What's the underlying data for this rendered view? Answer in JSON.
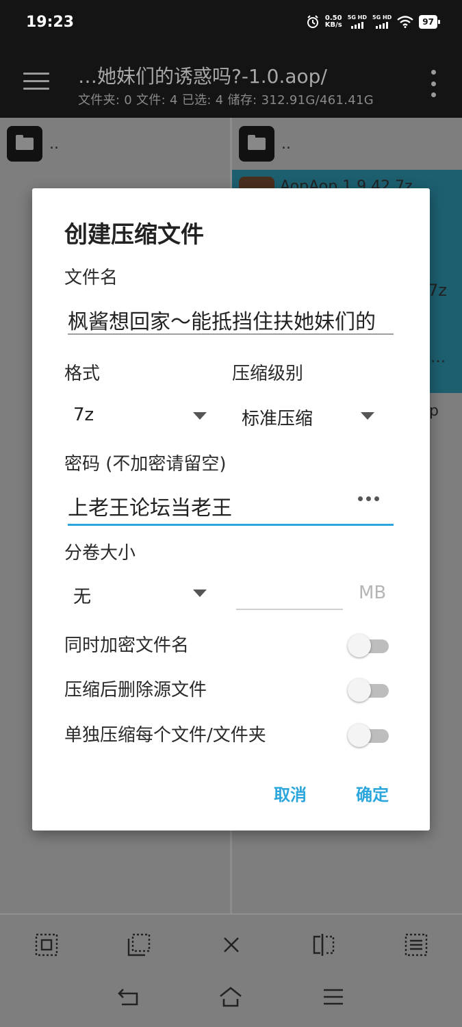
{
  "status_bar": {
    "time": "19:23",
    "net_speed_value": "0.50",
    "net_speed_unit": "KB/s",
    "sim1": "5G HD",
    "sim2": "5G HD",
    "battery": "97"
  },
  "app_bar": {
    "title": "…她妹们的诱惑吗?-1.0.aop/",
    "subtitle": "文件夹: 0  文件: 4  已选: 4  储存: 312.91G/461.41G"
  },
  "left_pane": {
    "parent_label": ".."
  },
  "right_pane": {
    "parent_label": "..",
    "selected_item": "AopAop 1.9.42.7z",
    "peek_1": "7z",
    "peek_2": "…",
    "peek_3": "p"
  },
  "dialog": {
    "title": "创建压缩文件",
    "filename_label": "文件名",
    "filename_value": "枫酱想回家～能抵挡住扶她妹们的",
    "format_label": "格式",
    "format_value": "7z",
    "level_label": "压缩级别",
    "level_value": "标准压缩",
    "password_label": "密码 (不加密请留空)",
    "password_value": "上老王论坛当老王",
    "split_label": "分卷大小",
    "split_value": "无",
    "split_unit": "MB",
    "toggles": [
      {
        "label": "同时加密文件名",
        "on": false
      },
      {
        "label": "压缩后删除源文件",
        "on": false
      },
      {
        "label": "单独压缩每个文件/文件夹",
        "on": false
      }
    ],
    "cancel_label": "取消",
    "confirm_label": "确定"
  },
  "colors": {
    "accent": "#2aa6dc",
    "bar_dark": "#141414",
    "selection": "#1d5f6f"
  },
  "toolbar_icons": [
    "select-all-icon",
    "select-range-icon",
    "close-icon",
    "compare-icon",
    "list-icon"
  ],
  "nav_icons": [
    "back-icon",
    "home-icon",
    "recents-icon"
  ]
}
